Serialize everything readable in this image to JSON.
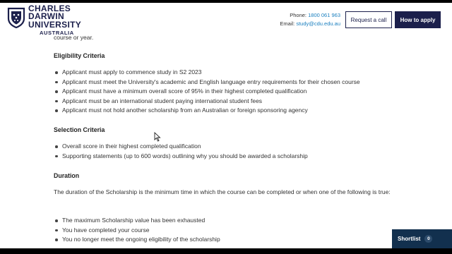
{
  "header": {
    "logo": {
      "line1": "CHARLES",
      "line2": "DARWIN UNIVERSITY",
      "line3": "AUSTRALIA"
    },
    "phone_label": "Phone:",
    "phone": "1800 061 963",
    "email_label": "Email:",
    "email": "study@cdu.edu.au",
    "request_call": "Request a call",
    "how_to_apply": "How to apply"
  },
  "content": {
    "prev_text": "course or year.",
    "eligibility": {
      "heading": "Eligibility Criteria",
      "items": [
        "Applicant must apply to commence study in S2 2023",
        "Applicant must meet the University's academic and English language entry requirements for their chosen course",
        "Applicant must have a minimum overall score of 95% in their highest completed qualification",
        "Applicant must be an international student paying international student fees",
        "Applicant must not hold another scholarship from an Australian or foreign sponsoring agency"
      ]
    },
    "selection": {
      "heading": "Selection Criteria",
      "items": [
        "Overall score in their highest completed qualification",
        "Supporting statements (up to 600 words) outlining why you should be awarded a scholarship"
      ]
    },
    "duration": {
      "heading": "Duration",
      "paragraph": "The duration of the Scholarship is the minimum time in which the course can be completed or when one of the following is true:",
      "items": [
        "The maximum Scholarship value has been exhausted",
        "You have completed your course",
        "You no longer meet the ongoing eligibility of the scholarship"
      ]
    }
  },
  "shortlist": {
    "label": "Shortlist",
    "count": "0"
  },
  "colors": {
    "navy": "#1b1f4b",
    "link": "#1a7fbf",
    "shortlist_bg": "#12304e"
  }
}
